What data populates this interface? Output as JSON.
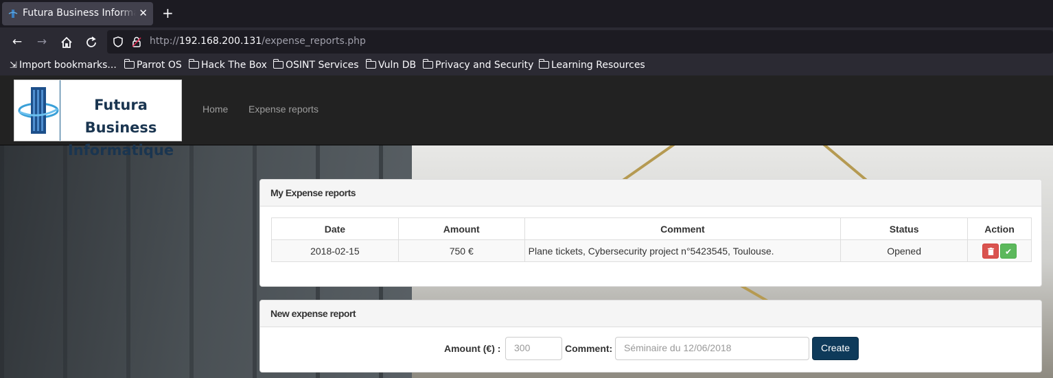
{
  "browser": {
    "tab_title": "Futura Business Informatique",
    "url_prefix": "http://",
    "url_host": "192.168.200.131",
    "url_path": "/expense_reports.php",
    "bookmarks": [
      "Import bookmarks...",
      "Parrot OS",
      "Hack The Box",
      "OSINT Services",
      "Vuln DB",
      "Privacy and Security",
      "Learning Resources"
    ]
  },
  "site": {
    "logo_line1": "Futura Business",
    "logo_line2": "Informatique",
    "nav": [
      "Home",
      "Expense reports"
    ]
  },
  "reports_panel": {
    "title": "My Expense reports",
    "columns": [
      "Date",
      "Amount",
      "Comment",
      "Status",
      "Action"
    ],
    "rows": [
      {
        "date": "2018-02-15",
        "amount": "750 €",
        "comment": "Plane tickets, Cybersecurity project n°5423545, Toulouse.",
        "status": "Opened"
      }
    ]
  },
  "new_panel": {
    "title": "New expense report",
    "amount_label": "Amount (€) :",
    "amount_placeholder": "300",
    "comment_label": "Comment:",
    "comment_placeholder": "Séminaire du 12/06/2018",
    "create_label": "Create"
  },
  "colors": {
    "navbar": "#222222",
    "create_button": "#0e3a5a",
    "delete": "#d9534f",
    "approve": "#5cb85c"
  }
}
